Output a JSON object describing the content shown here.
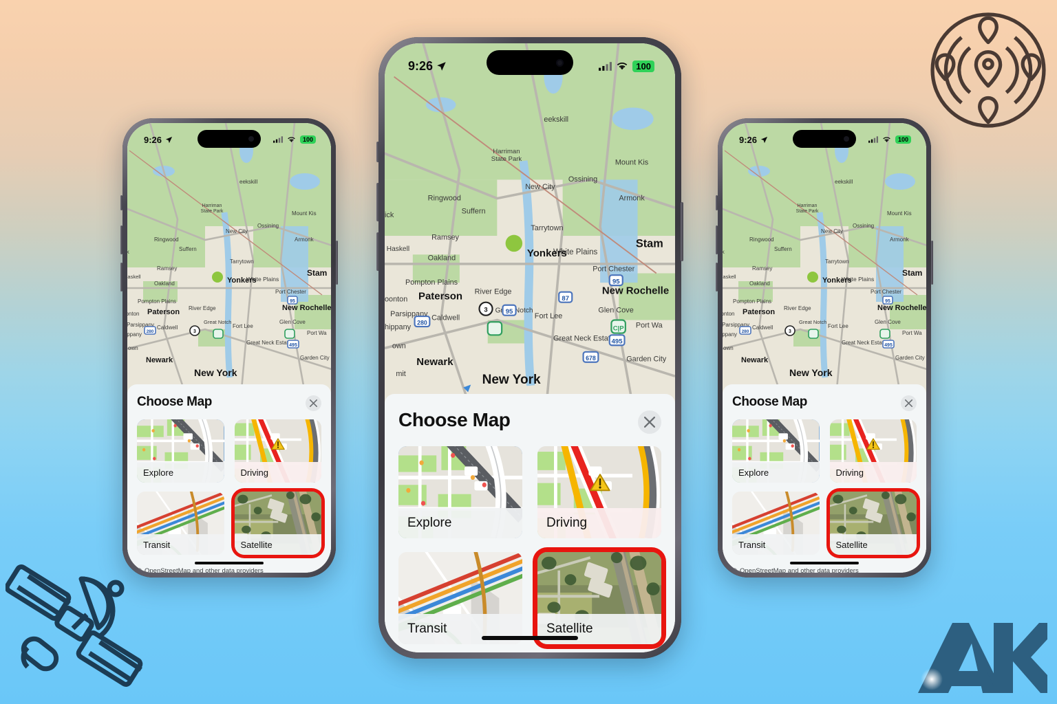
{
  "background": {
    "top_color": "#f9d2ae",
    "bottom_color": "#6ac7f8"
  },
  "brand": {
    "compass_logo_name": "location-pins-compass-logo",
    "satellite_logo_name": "satellite-icon",
    "ak_logo_text": "AK",
    "ak_logo_color": "#2d5f80"
  },
  "status_bar": {
    "time": "9:26",
    "location_arrow_icon": "location-arrow-icon",
    "cellular_icon": "cellular-signal-icon",
    "wifi_icon": "wifi-icon",
    "battery_percent": "100",
    "battery_color": "#2fd158"
  },
  "sheet": {
    "title": "Choose Map",
    "close_icon": "close-icon",
    "attribution": "OpenStreetMap and other data providers",
    "attribution_mark": "©",
    "options": [
      {
        "label": "Explore",
        "state": "selected",
        "thumb": "explore-map-thumbnail",
        "accent": "#2f7fd0"
      },
      {
        "label": "Driving",
        "state": "default",
        "thumb": "driving-map-thumbnail",
        "accent": "#f3c21a"
      },
      {
        "label": "Transit",
        "state": "default",
        "thumb": "transit-map-thumbnail",
        "accent": "#2f7fd0"
      },
      {
        "label": "Satellite",
        "state": "highlighted",
        "thumb": "satellite-map-thumbnail",
        "accent": "#e8150f"
      }
    ]
  },
  "map": {
    "labels_major": [
      "New York",
      "Yonkers",
      "Newark",
      "Paterson",
      "New Rochelle",
      "Stam"
    ],
    "labels_minor": [
      "Harriman State Park",
      "Ringwood",
      "Suffern",
      "New City",
      "Ossining",
      "Peekskill",
      "Mount Kis",
      "Armonk",
      "Ramsey",
      "Tarrytown",
      "Haskell",
      "Oakland",
      "White Plains",
      "Port Chester",
      "Pompton Plains",
      "River Edge",
      "Boonton",
      "Parsippany",
      "Great Notch",
      "Caldwell",
      "Fort Lee",
      "Glen Cove",
      "Port Wa",
      "Great Neck Estates",
      "Garden City",
      "Whippany",
      "town",
      "mit",
      "ick"
    ],
    "shields": [
      "87",
      "95",
      "280",
      "678",
      "495",
      "3",
      "I-95"
    ],
    "poi_icons": [
      "park-pin-icon",
      "airport-icon",
      "golf-icon",
      "park-icon"
    ]
  },
  "phones": [
    {
      "id": "left",
      "size": "small",
      "role": "duplicate-view"
    },
    {
      "id": "center",
      "size": "large",
      "role": "primary-view"
    },
    {
      "id": "right",
      "size": "small",
      "role": "duplicate-view"
    }
  ]
}
